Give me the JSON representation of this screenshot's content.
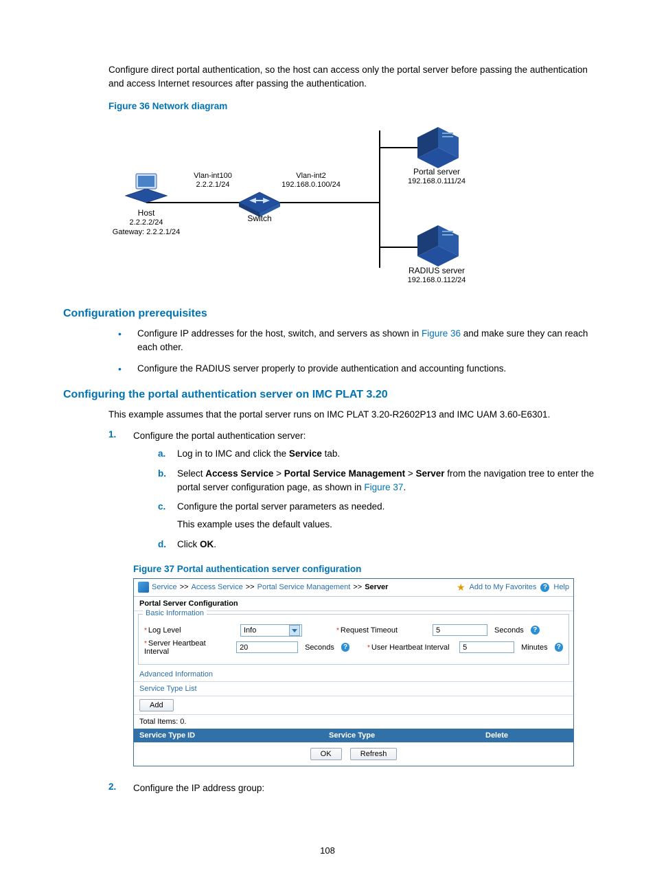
{
  "intro": "Configure direct portal authentication, so the host can access only the portal server before passing the authentication and access Internet resources after passing the authentication.",
  "fig36_caption": "Figure 36 Network diagram",
  "diagram": {
    "host_name": "Host",
    "host_ip": "2.2.2.2/24",
    "host_gw": "Gateway: 2.2.2.1/24",
    "vlan100_name": "Vlan-int100",
    "vlan100_ip": "2.2.2.1/24",
    "switch": "Switch",
    "vlan2_name": "Vlan-int2",
    "vlan2_ip": "192.168.0.100/24",
    "portal_name": "Portal server",
    "portal_ip": "192.168.0.111/24",
    "radius_name": "RADIUS server",
    "radius_ip": "192.168.0.112/24"
  },
  "h_prereq": "Configuration prerequisites",
  "prereqs": {
    "b1a": "Configure IP addresses for the host, switch, and servers as shown in ",
    "b1link": "Figure 36",
    "b1b": " and make sure they can reach each other.",
    "b2": "Configure the RADIUS server properly to provide authentication and accounting functions."
  },
  "h_config": "Configuring the portal authentication server on IMC PLAT 3.20",
  "config_intro": "This example assumes that the portal server runs on IMC PLAT 3.20-R2602P13 and IMC UAM 3.60-E6301.",
  "steps": {
    "s1_num": "1.",
    "s1_text": "Configure the portal authentication server:",
    "a_l": "a.",
    "a_t1": "Log in to IMC and click the ",
    "a_bold": "Service",
    "a_t2": " tab.",
    "b_l": "b.",
    "b_t1": "Select ",
    "b_b1": "Access Service",
    "b_sep": " > ",
    "b_b2": "Portal Service Management",
    "b_b3": "Server",
    "b_t2": " from the navigation tree to enter the portal server configuration page, as shown in ",
    "b_link": "Figure 37",
    "b_t3": ".",
    "c_l": "c.",
    "c_t": "Configure the portal server parameters as needed.",
    "c_sub": "This example uses the default values.",
    "d_l": "d.",
    "d_t1": "Click ",
    "d_bold": "OK",
    "d_t2": ".",
    "s2_num": "2.",
    "s2_text": "Configure the IP address group:"
  },
  "fig37_caption": "Figure 37 Portal authentication server configuration",
  "ui": {
    "bc1": "Service",
    "bc2": "Access Service",
    "bc3": "Portal Service Management",
    "bc4": "Server",
    "sep": ">>",
    "fav": "Add to My Favorites",
    "help": "Help",
    "section_title": "Portal Server Configuration",
    "basic_legend": "Basic Information",
    "log_level_lbl": "Log Level",
    "log_level_val": "Info",
    "req_timeout_lbl": "Request Timeout",
    "req_timeout_val": "5",
    "seconds": "Seconds",
    "server_hb_lbl": "Server Heartbeat Interval",
    "server_hb_val": "20",
    "user_hb_lbl": "User Heartbeat Interval",
    "user_hb_val": "5",
    "minutes": "Minutes",
    "advanced": "Advanced Information",
    "service_type_list": "Service Type List",
    "add_btn": "Add",
    "total_items": "Total Items: 0.",
    "th_id": "Service Type ID",
    "th_type": "Service Type",
    "th_delete": "Delete",
    "ok": "OK",
    "refresh": "Refresh"
  },
  "page_num": "108"
}
